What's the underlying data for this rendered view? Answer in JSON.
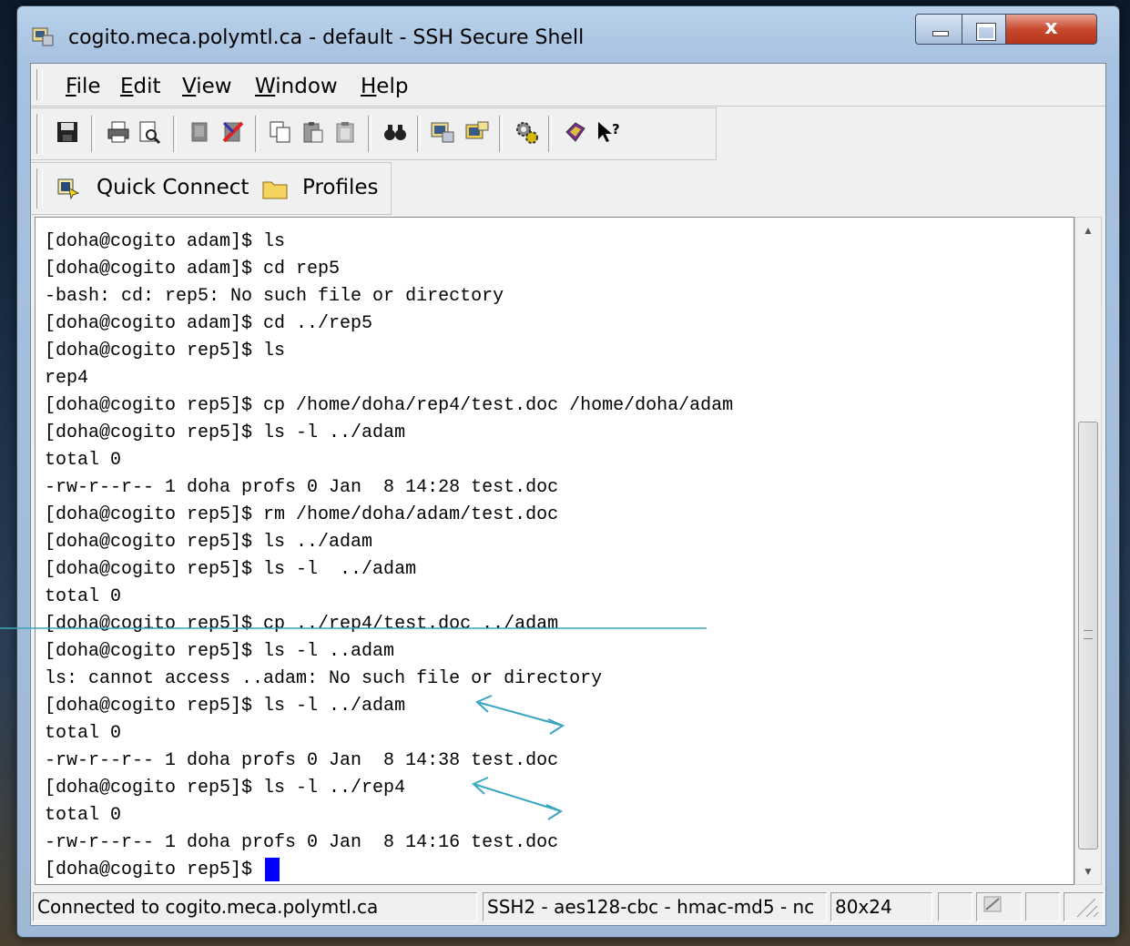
{
  "window": {
    "title": "cogito.meca.polymtl.ca - default - SSH Secure Shell",
    "close_glyph": "x"
  },
  "menu": [
    {
      "label": "File",
      "accel": "F",
      "rest": "ile"
    },
    {
      "label": "Edit",
      "accel": "E",
      "rest": "dit"
    },
    {
      "label": "View",
      "accel": "V",
      "rest": "iew"
    },
    {
      "label": "Window",
      "accel": "W",
      "rest": "indow"
    },
    {
      "label": "Help",
      "accel": "H",
      "rest": "elp"
    }
  ],
  "toolbar": {
    "icons": [
      "save-icon",
      "print-icon",
      "print-preview-icon",
      "disconnect-icon",
      "disconnect-red-icon",
      "copy-icon",
      "paste-icon",
      "paste-alt-icon",
      "find-icon",
      "new-terminal-icon",
      "new-file-transfer-icon",
      "settings-icon",
      "help-book-icon",
      "context-help-icon"
    ]
  },
  "quickbar": {
    "quick_connect": "Quick Connect",
    "profiles": "Profiles"
  },
  "terminal": {
    "lines": [
      "[doha@cogito adam]$ ls",
      "[doha@cogito adam]$ cd rep5",
      "-bash: cd: rep5: No such file or directory",
      "[doha@cogito adam]$ cd ../rep5",
      "[doha@cogito rep5]$ ls",
      "rep4",
      "[doha@cogito rep5]$ cp /home/doha/rep4/test.doc /home/doha/adam",
      "[doha@cogito rep5]$ ls -l ../adam",
      "total 0",
      "-rw-r--r-- 1 doha profs 0 Jan  8 14:28 test.doc",
      "[doha@cogito rep5]$ rm /home/doha/adam/test.doc",
      "[doha@cogito rep5]$ ls ../adam",
      "[doha@cogito rep5]$ ls -l  ../adam",
      "total 0",
      "[doha@cogito rep5]$ cp ../rep4/test.doc ../adam",
      "[doha@cogito rep5]$ ls -l ..adam",
      "ls: cannot access ..adam: No such file or directory",
      "[doha@cogito rep5]$ ls -l ../adam",
      "total 0",
      "-rw-r--r-- 1 doha profs 0 Jan  8 14:38 test.doc",
      "[doha@cogito rep5]$ ls -l ../rep4",
      "total 0",
      "-rw-r--r-- 1 doha profs 0 Jan  8 14:16 test.doc",
      "[doha@cogito rep5]$ "
    ]
  },
  "status": {
    "connection": "Connected to cogito.meca.polymtl.ca",
    "cipher": "SSH2 - aes128-cbc - hmac-md5 - nc",
    "size": "80x24"
  },
  "colors": {
    "cursor": "#0000ff",
    "annotation": "#3aa6c0"
  }
}
